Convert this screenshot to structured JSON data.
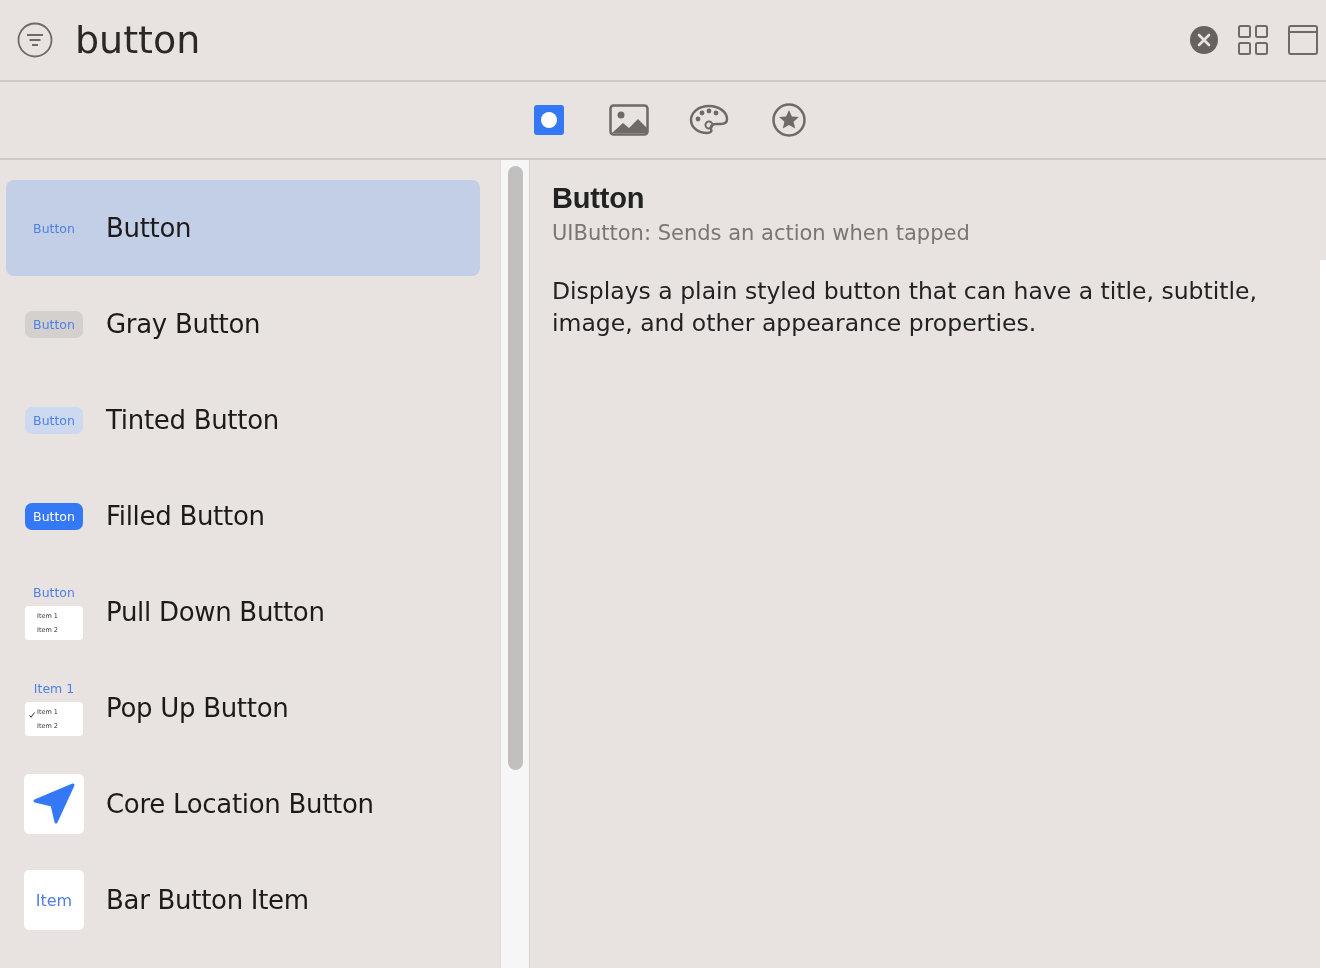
{
  "search": {
    "value": "button"
  },
  "tabs": [
    {
      "kind": "controls",
      "selected": true
    },
    {
      "kind": "media",
      "selected": false
    },
    {
      "kind": "colors",
      "selected": false
    },
    {
      "kind": "symbols",
      "selected": false
    }
  ],
  "items": [
    {
      "title": "Button",
      "kind": "plain",
      "preview": [
        "Button"
      ],
      "selected": true
    },
    {
      "title": "Gray Button",
      "kind": "gray",
      "preview": [
        "Button"
      ],
      "selected": false
    },
    {
      "title": "Tinted Button",
      "kind": "tinted",
      "preview": [
        "Button"
      ],
      "selected": false
    },
    {
      "title": "Filled Button",
      "kind": "filled",
      "preview": [
        "Button"
      ],
      "selected": false
    },
    {
      "title": "Pull Down Button",
      "kind": "pulldown",
      "preview": [
        "Button",
        "Item 1",
        "Item 2"
      ],
      "selected": false
    },
    {
      "title": "Pop Up Button",
      "kind": "popup",
      "preview": [
        "Item 1",
        "Item 1",
        "Item 2"
      ],
      "selected": false
    },
    {
      "title": "Core Location Button",
      "kind": "location",
      "selected": false
    },
    {
      "title": "Bar Button Item",
      "kind": "baritem",
      "preview": [
        "Item"
      ],
      "selected": false
    }
  ],
  "detail": {
    "title": "Button",
    "subtitle": "UIButton: Sends an action when tapped",
    "description": "Displays a plain styled button that can have a title, subtitle, image, and other appearance properties."
  }
}
